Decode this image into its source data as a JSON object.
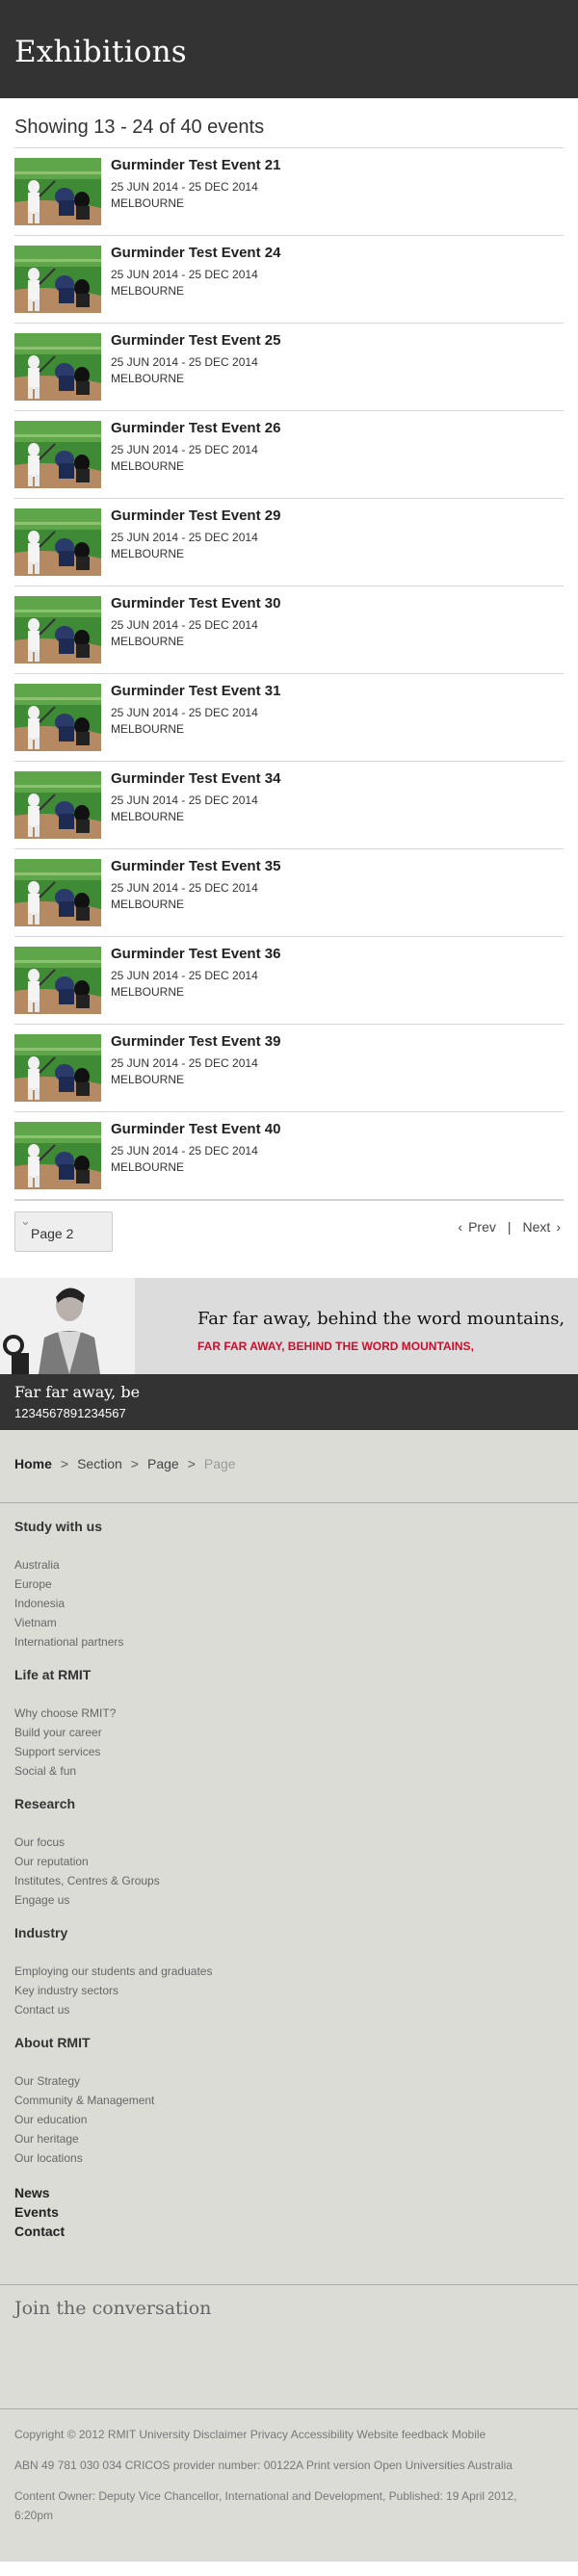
{
  "header": {
    "title": "Exhibitions"
  },
  "results": {
    "summary": "Showing 13 - 24 of 40 events",
    "events": [
      {
        "title": "Gurminder Test Event 21",
        "date": "25 JUN 2014 - 25 DEC 2014",
        "location": "MELBOURNE"
      },
      {
        "title": "Gurminder Test Event 24",
        "date": "25 JUN 2014 - 25 DEC 2014",
        "location": "MELBOURNE"
      },
      {
        "title": "Gurminder Test Event 25",
        "date": "25 JUN 2014 - 25 DEC 2014",
        "location": "MELBOURNE"
      },
      {
        "title": "Gurminder Test Event 26",
        "date": "25 JUN 2014 - 25 DEC 2014",
        "location": "MELBOURNE"
      },
      {
        "title": "Gurminder Test Event 29",
        "date": "25 JUN 2014 - 25 DEC 2014",
        "location": "MELBOURNE"
      },
      {
        "title": "Gurminder Test Event 30",
        "date": "25 JUN 2014 - 25 DEC 2014",
        "location": "MELBOURNE"
      },
      {
        "title": "Gurminder Test Event 31",
        "date": "25 JUN 2014 - 25 DEC 2014",
        "location": "MELBOURNE"
      },
      {
        "title": "Gurminder Test Event 34",
        "date": "25 JUN 2014 - 25 DEC 2014",
        "location": "MELBOURNE"
      },
      {
        "title": "Gurminder Test Event 35",
        "date": "25 JUN 2014 - 25 DEC 2014",
        "location": "MELBOURNE"
      },
      {
        "title": "Gurminder Test Event 36",
        "date": "25 JUN 2014 - 25 DEC 2014",
        "location": "MELBOURNE"
      },
      {
        "title": "Gurminder Test Event 39",
        "date": "25 JUN 2014 - 25 DEC 2014",
        "location": "MELBOURNE"
      },
      {
        "title": "Gurminder Test Event 40",
        "date": "25 JUN 2014 - 25 DEC 2014",
        "location": "MELBOURNE"
      }
    ]
  },
  "pager": {
    "page_label": "Page 2",
    "prev": "Prev",
    "separator": "|",
    "next": "Next",
    "prev_icon": "‹",
    "next_icon": "›"
  },
  "promo": {
    "title": "Far far away, behind the word mountains,",
    "subtitle": "FAR FAR AWAY, BEHIND THE WORD MOUNTAINS,"
  },
  "banner": {
    "title": "Far far away, be",
    "number": "1234567891234567"
  },
  "breadcrumb": {
    "home": "Home",
    "section": "Section",
    "page1": "Page",
    "page2": "Page",
    "sep": ">"
  },
  "footer_nav": [
    {
      "heading": "Study with us",
      "links": [
        "Australia",
        "Europe",
        "Indonesia",
        "Vietnam",
        "International partners"
      ]
    },
    {
      "heading": "Life at RMIT",
      "links": [
        "Why choose RMIT?",
        "Build your career",
        "Support services",
        "Social & fun"
      ]
    },
    {
      "heading": "Research",
      "links": [
        "Our focus",
        "Our reputation",
        "Institutes, Centres & Groups",
        "Engage us"
      ]
    },
    {
      "heading": "Industry",
      "links": [
        "Employing our students and graduates",
        "Key industry sectors",
        "Contact us"
      ]
    },
    {
      "heading": "About RMIT",
      "links": [
        "Our Strategy",
        "Community & Management",
        "Our education",
        "Our heritage",
        "Our locations"
      ]
    }
  ],
  "footer_plain": [
    "News",
    "Events",
    "Contact"
  ],
  "join": {
    "title": "Join the conversation"
  },
  "legal": {
    "copyright": "Copyright © 2012 RMIT University Disclaimer Privacy Accessibility Website feedback Mobile",
    "abn": "ABN 49 781 030 034 CRICOS provider number: 00122A Print version Open Universities Australia",
    "owner": "Content Owner: Deputy Vice Chancellor, International and Development, Published: 19 April 2012, 6:20pm"
  },
  "colors": {
    "header_bg": "#333333",
    "promo_accent": "#c8102e",
    "footer_bg": "#dcdcd7"
  }
}
